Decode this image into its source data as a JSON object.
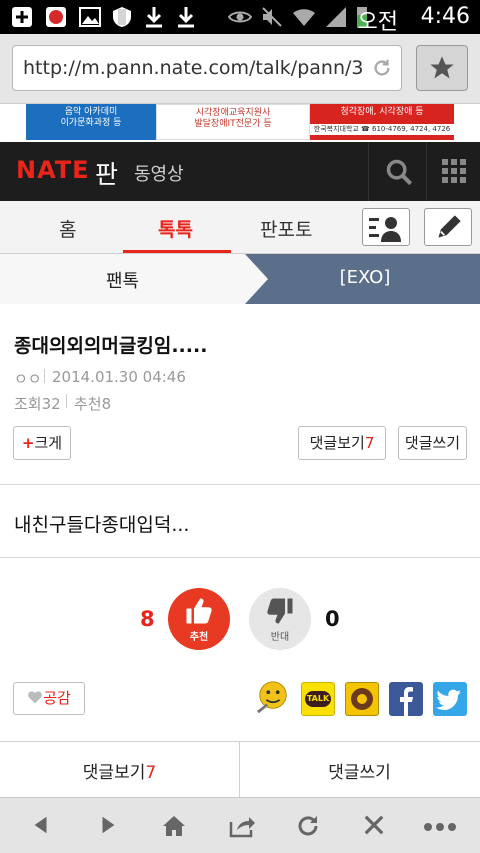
{
  "status_bar": {
    "time": "4:46",
    "lang": "오전",
    "icons": [
      "add-icon",
      "app-icon",
      "image-icon",
      "shield-icon",
      "download-icon",
      "download-icon",
      "eye-icon",
      "mute-icon",
      "wifi-icon",
      "signal-icon",
      "battery-icon"
    ]
  },
  "browser": {
    "url": "http://m.pann.nate.com/talk/pann/3"
  },
  "banner": {
    "ad1": "음악 아카데미\n이가문화과정 등",
    "ad2": "시각장애교육지원사\n발달장애IT전문가 등",
    "ad3": "청각장애, 시각장애 등",
    "ad3_phone": "한국복지대학교 ☎ 610-4769, 4724, 4726"
  },
  "header": {
    "logo": "NATE",
    "section": "판",
    "video_label": "동영상"
  },
  "tabs": {
    "home": "홈",
    "talk": "톡톡",
    "photo": "판포토"
  },
  "subnav": {
    "left": "팬톡",
    "right": "[EXO]"
  },
  "article": {
    "title": "종대의외의머글킹임.....",
    "author": "ㅇㅇ",
    "date": "2014.01.30 04:46",
    "views": "조회32",
    "recommends": "추천8",
    "font_btn_plus": "+",
    "font_btn": "크게",
    "comments_btn_label": "댓글보기",
    "comments_btn_count": "7",
    "write_comment_btn": "댓글쓰기",
    "body": "내친구들다종대입덕..."
  },
  "vote": {
    "up_count": "8",
    "up_label": "추천",
    "down_count": "0",
    "down_label": "반대"
  },
  "share": {
    "like_label": "공감",
    "kakaotalk": "TALK"
  },
  "bottom_tabs": {
    "comments_label": "댓글보기",
    "comments_count": "7",
    "write_label": "댓글쓰기"
  },
  "colors": {
    "accent": "#e8241b",
    "header_bg": "#1d1d1d",
    "subnav_active": "#5b6e8a",
    "facebook": "#3b5998",
    "twitter": "#35a6e8",
    "kakao": "#f9e000"
  }
}
